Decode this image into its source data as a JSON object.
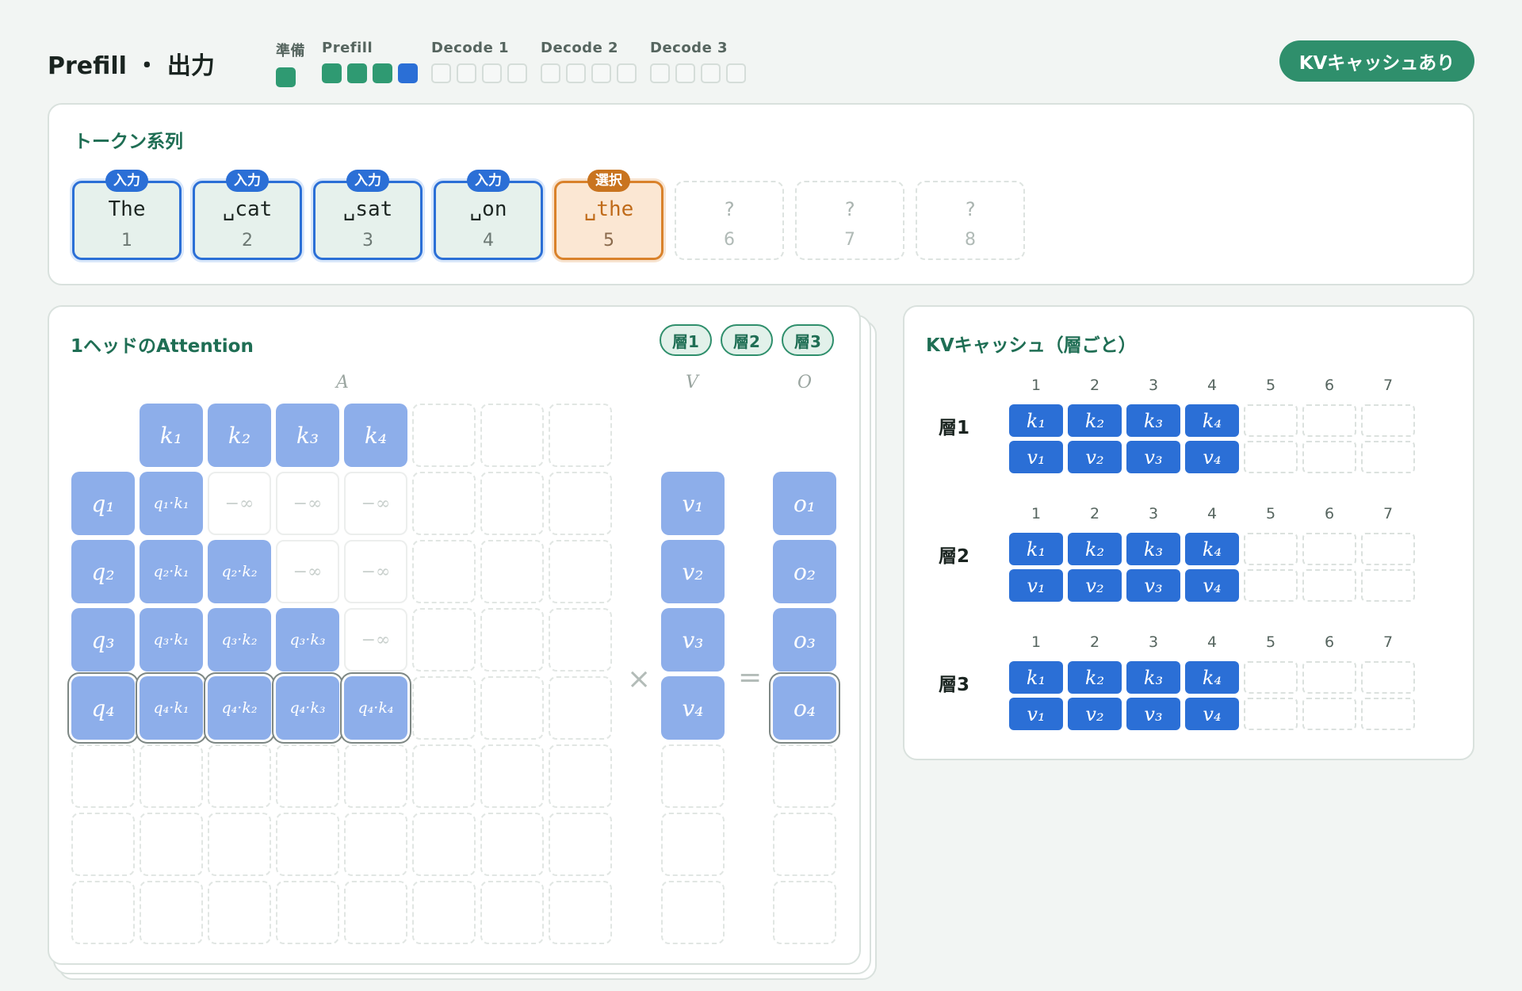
{
  "header": {
    "title": "Prefill ・ 出力",
    "stages": [
      {
        "label": "準備",
        "boxes": [
          "green"
        ]
      },
      {
        "label": "Prefill",
        "boxes": [
          "green",
          "green",
          "green",
          "blue"
        ]
      },
      {
        "label": "Decode 1",
        "boxes": [
          "empty",
          "empty",
          "empty",
          "empty"
        ]
      },
      {
        "label": "Decode 2",
        "boxes": [
          "empty",
          "empty",
          "empty",
          "empty"
        ]
      },
      {
        "label": "Decode 3",
        "boxes": [
          "empty",
          "empty",
          "empty",
          "empty"
        ]
      }
    ],
    "kv_button_label": "KVキャッシュあり"
  },
  "tokens": {
    "title": "トークン系列",
    "items": [
      {
        "text": "The",
        "num": "1",
        "state": "input",
        "badge": "入力"
      },
      {
        "text": "␣cat",
        "num": "2",
        "state": "input",
        "badge": "入力"
      },
      {
        "text": "␣sat",
        "num": "3",
        "state": "input",
        "badge": "入力"
      },
      {
        "text": "␣on",
        "num": "4",
        "state": "input",
        "badge": "入力"
      },
      {
        "text": "␣the",
        "num": "5",
        "state": "selected",
        "badge": "選択"
      },
      {
        "text": "?",
        "num": "6",
        "state": "empty",
        "badge": ""
      },
      {
        "text": "?",
        "num": "7",
        "state": "empty",
        "badge": ""
      },
      {
        "text": "?",
        "num": "8",
        "state": "empty",
        "badge": ""
      }
    ]
  },
  "attention": {
    "title": "1ヘッドのAttention",
    "layer_pills": [
      "層1",
      "層2",
      "層3"
    ],
    "labels": {
      "A": "A",
      "V": "V",
      "O": "O"
    },
    "operators": {
      "times": "×",
      "equals": "="
    },
    "keys": [
      "k₁",
      "k₂",
      "k₃",
      "k₄"
    ],
    "queries": [
      "q₁",
      "q₂",
      "q₃",
      "q₄"
    ],
    "scores": [
      [
        "q₁·k₁",
        "−∞",
        "−∞",
        "−∞"
      ],
      [
        "q₂·k₁",
        "q₂·k₂",
        "−∞",
        "−∞"
      ],
      [
        "q₃·k₁",
        "q₃·k₂",
        "q₃·k₃",
        "−∞"
      ],
      [
        "q₄·k₁",
        "q₄·k₂",
        "q₄·k₃",
        "q₄·k₄"
      ]
    ],
    "mask_value": "−∞",
    "values": [
      "v₁",
      "v₂",
      "v₃",
      "v₄"
    ],
    "outputs": [
      "o₁",
      "o₂",
      "o₃",
      "o₄"
    ],
    "highlighted_row": 4
  },
  "kv_cache": {
    "title": "KVキャッシュ（層ごと）",
    "columns": [
      "1",
      "2",
      "3",
      "4",
      "5",
      "6",
      "7"
    ],
    "layers": [
      {
        "name": "層1",
        "k": [
          "k₁",
          "k₂",
          "k₃",
          "k₄"
        ],
        "v": [
          "v₁",
          "v₂",
          "v₃",
          "v₄"
        ]
      },
      {
        "name": "層2",
        "k": [
          "k₁",
          "k₂",
          "k₃",
          "k₄"
        ],
        "v": [
          "v₁",
          "v₂",
          "v₃",
          "v₄"
        ]
      },
      {
        "name": "層3",
        "k": [
          "k₁",
          "k₂",
          "k₃",
          "k₄"
        ],
        "v": [
          "v₁",
          "v₂",
          "v₃",
          "v₄"
        ]
      }
    ]
  }
}
